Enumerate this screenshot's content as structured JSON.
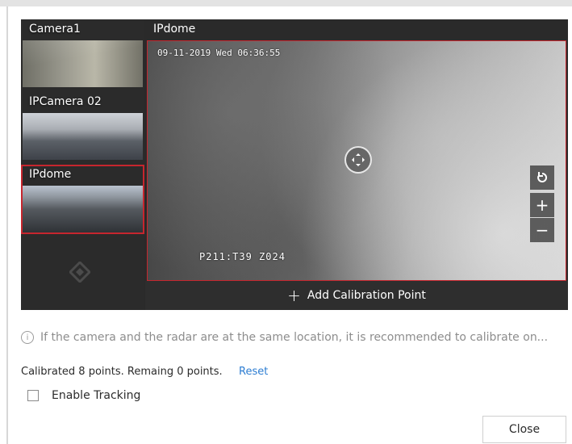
{
  "cameras": [
    {
      "label": "Camera1"
    },
    {
      "label": "IPCamera 02"
    },
    {
      "label": "IPdome"
    }
  ],
  "selected_camera": {
    "title": "IPdome",
    "timestamp": "09-11-2019 Wed 06:36:55",
    "ptz_readout": "P211:T39   Z024"
  },
  "controls": {
    "refresh_icon": "refresh-icon",
    "zoom_in_label": "+",
    "zoom_out_label": "−",
    "move_icon": "move-arrows-icon"
  },
  "calibration": {
    "add_label": "Add Calibration Point",
    "plus_label": "+"
  },
  "info_text": "If the camera and the radar are at the same location, it is recommended to calibrate on...",
  "status": {
    "text": "Calibrated 8 points. Remaing 0 points.",
    "reset_label": "Reset"
  },
  "tracking": {
    "label": "Enable Tracking",
    "checked": false
  },
  "close_label": "Close",
  "colors": {
    "accent_red": "#c6262e",
    "link_blue": "#2d7dd2",
    "viewer_bg": "#2a2a2a"
  }
}
